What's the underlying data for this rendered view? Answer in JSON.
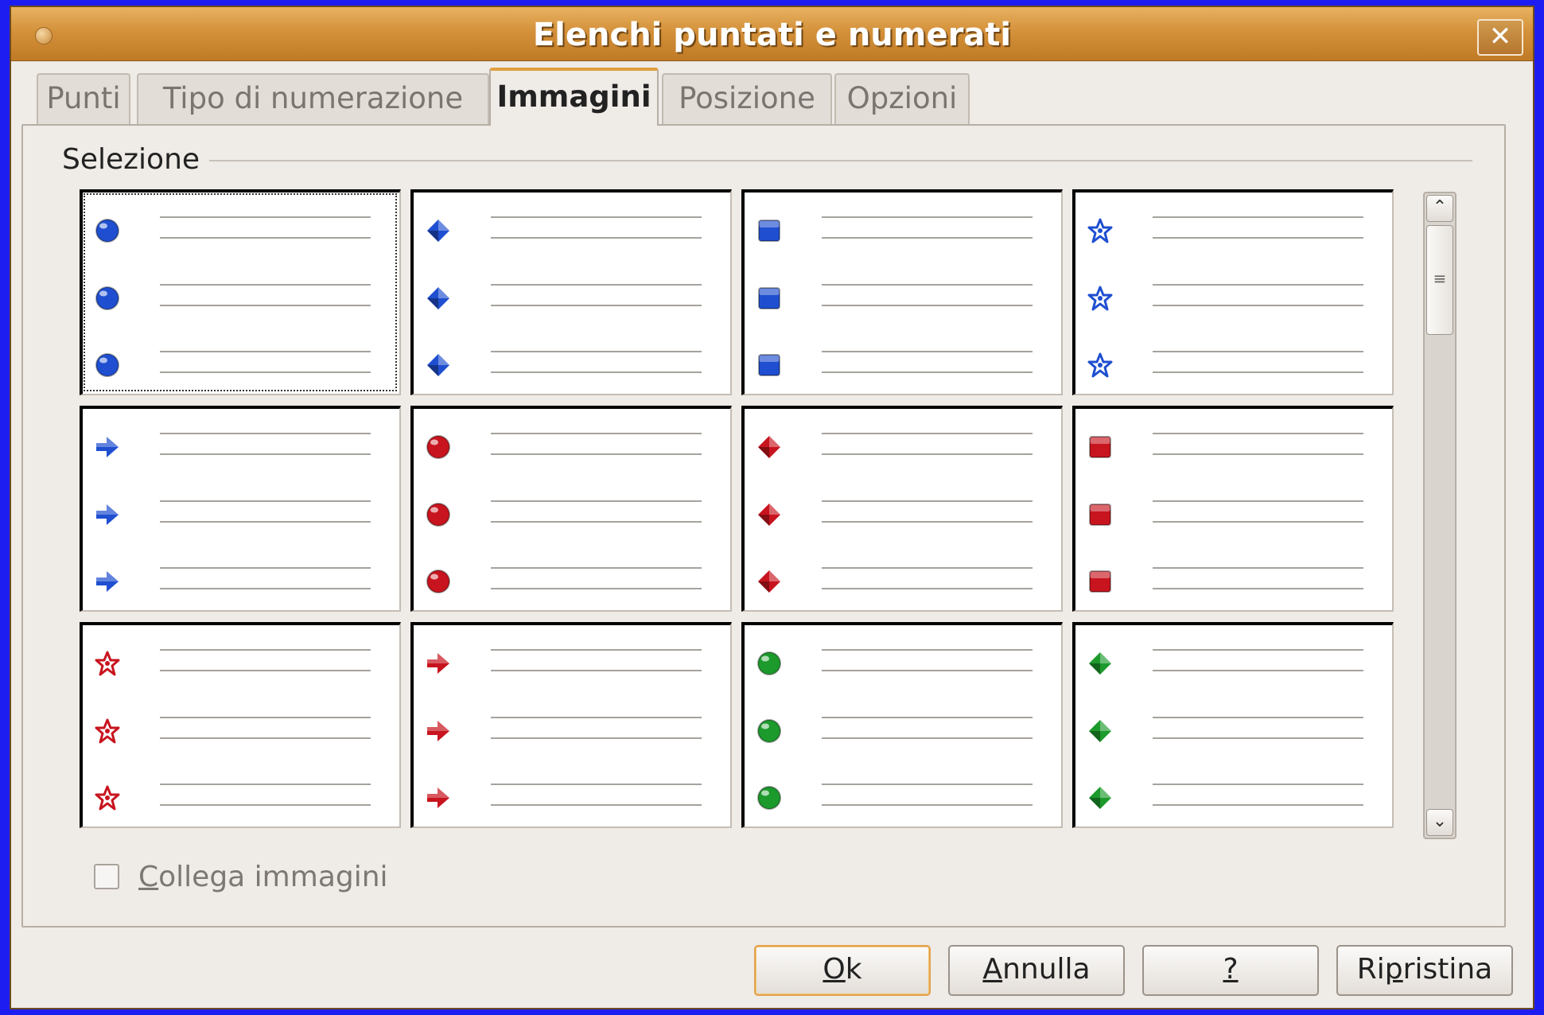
{
  "window": {
    "title": "Elenchi puntati e numerati",
    "close_label": "✕"
  },
  "tabs": [
    {
      "label": "Punti",
      "active": false
    },
    {
      "label": "Tipo di numerazione",
      "active": false
    },
    {
      "label": "Immagini",
      "active": true
    },
    {
      "label": "Posizione",
      "active": false
    },
    {
      "label": "Opzioni",
      "active": false
    }
  ],
  "selection": {
    "label": "Selezione",
    "bullets": [
      {
        "icon": "blue-sphere-icon",
        "color": "#1f4fd0",
        "shape": "sphere",
        "selected": true
      },
      {
        "icon": "blue-diamond-icon",
        "color": "#1f4fd0",
        "shape": "diamond"
      },
      {
        "icon": "blue-square-icon",
        "color": "#1f4fd0",
        "shape": "square"
      },
      {
        "icon": "blue-star-icon",
        "color": "#1f4fd0",
        "shape": "star"
      },
      {
        "icon": "blue-arrow-icon",
        "color": "#1f4fd0",
        "shape": "arrow"
      },
      {
        "icon": "red-sphere-icon",
        "color": "#c8141e",
        "shape": "sphere"
      },
      {
        "icon": "red-diamond-icon",
        "color": "#c8141e",
        "shape": "diamond"
      },
      {
        "icon": "red-square-icon",
        "color": "#c8141e",
        "shape": "square"
      },
      {
        "icon": "red-star-icon",
        "color": "#c8141e",
        "shape": "star"
      },
      {
        "icon": "red-arrow-icon",
        "color": "#c8141e",
        "shape": "arrow"
      },
      {
        "icon": "green-sphere-icon",
        "color": "#1c9a2c",
        "shape": "sphere"
      },
      {
        "icon": "green-diamond-icon",
        "color": "#1c9a2c",
        "shape": "diamond"
      }
    ]
  },
  "scrollbar": {
    "up_icon": "⌃",
    "down_icon": "⌄",
    "grip": "≡"
  },
  "link_images": {
    "label_accel": "C",
    "label_rest": "ollega immagini",
    "checked": false
  },
  "buttons": {
    "ok": {
      "accel": "O",
      "rest": "k"
    },
    "cancel": {
      "pre": "",
      "accel": "A",
      "rest": "nnulla"
    },
    "help": {
      "accel": "?"
    },
    "reset": {
      "pre": "Ri",
      "accel": "p",
      "rest": "ristina"
    }
  }
}
